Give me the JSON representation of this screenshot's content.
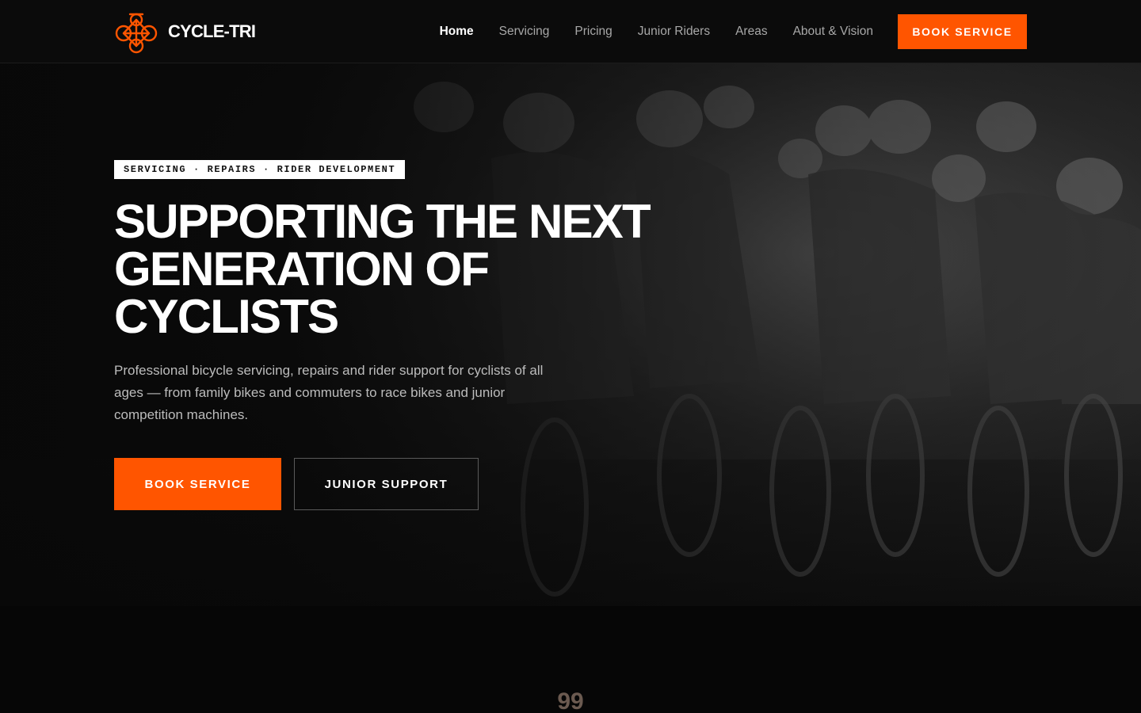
{
  "brand": {
    "name": "CYCLE-TRI",
    "logo_icon": "bicycle-logo-icon",
    "accent": "#ff5500"
  },
  "nav": {
    "links": [
      {
        "label": "Home",
        "active": true
      },
      {
        "label": "Servicing"
      },
      {
        "label": "Pricing"
      },
      {
        "label": "Junior Riders"
      },
      {
        "label": "Areas"
      },
      {
        "label": "About & Vision"
      }
    ],
    "cta_label": "BOOK SERVICE"
  },
  "hero": {
    "tagline": "SERVICING · REPAIRS · RIDER DEVELOPMENT",
    "headline_lines": [
      "SUPPORTING THE NEXT",
      "GENERATION OF",
      "CYCLISTS"
    ],
    "intro": "Professional bicycle servicing, repairs and rider support for cyclists of all ages — from family bikes and commuters to race bikes and junior competition machines.",
    "primary_cta": "BOOK SERVICE",
    "secondary_cta": "JUNIOR SUPPORT",
    "background_image": "monochrome photo of a pack of road cyclists racing"
  },
  "stats": {
    "number": "99"
  }
}
